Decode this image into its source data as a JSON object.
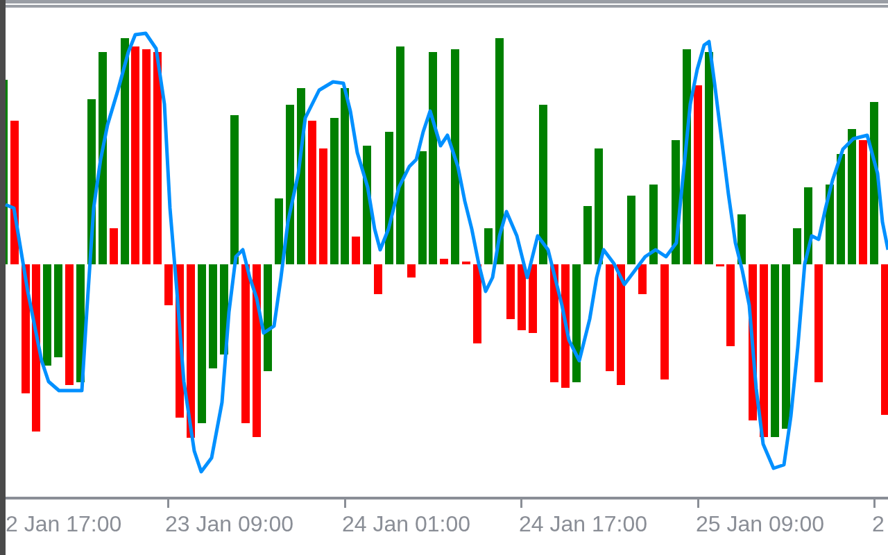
{
  "chart": {
    "time_axis": {
      "labels": [
        "2 Jan 17:00",
        "23 Jan 09:00",
        "24 Jan 01:00",
        "24 Jan 17:00",
        "25 Jan 09:00",
        "2"
      ]
    }
  }
}
